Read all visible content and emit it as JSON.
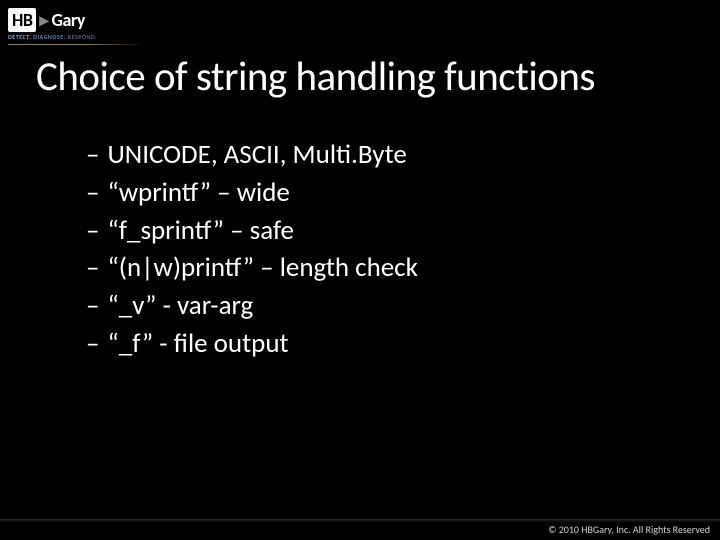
{
  "logo": {
    "hb": "HB",
    "gary": "Gary",
    "tagline_detect": "DETECT.",
    "tagline_diagnose": "DIAGNOSE.",
    "tagline_respond": "RESPOND."
  },
  "title": "Choice of string handling functions",
  "bullets": [
    "UNICODE, ASCII, Multi.Byte",
    "“wprintf” – wide",
    "“f_sprintf” – safe",
    "“(n|w)printf” – length check",
    "“_v” - var-arg",
    "“_f” - file output"
  ],
  "copyright": "© 2010 HBGary, Inc. All Rights Reserved"
}
